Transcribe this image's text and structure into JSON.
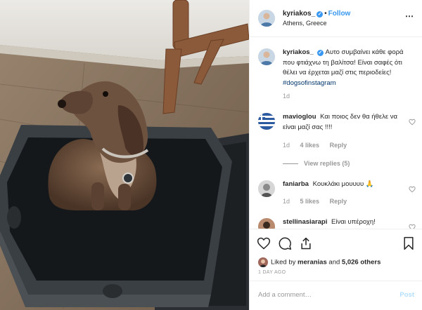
{
  "post": {
    "username": "kyriakos_",
    "verified_mark": "✓",
    "separator": "•",
    "follow_label": "Follow",
    "location": "Athens, Greece",
    "more_icon": "ellipsis-icon",
    "caption_user": "kyriakos_",
    "caption_text": "Αυτο συμβαίνει κάθε φορά που φτιάχνω τη βαλίτσα! Είναι σαφές ότι θέλει να έρχεται μαζί στις περιοδείες!",
    "caption_hashtag": "#dogsofinstagram",
    "caption_age": "1d"
  },
  "comments": [
    {
      "user": "mavioglou",
      "text": "Και ποιος δεν θα ήθελε να είναι μαζί σας !!!!",
      "age": "1d",
      "likes": "4 likes",
      "reply": "Reply",
      "view_replies": "View replies (5)"
    },
    {
      "user": "faniarba",
      "text": "Κουκλάκι μουυυυ 🙏",
      "age": "1d",
      "likes": "5 likes",
      "reply": "Reply"
    },
    {
      "user": "stellinasiarapi",
      "text": "Είναι υπέροχη!"
    }
  ],
  "actions": {
    "liked_prefix": "Liked by",
    "liked_user": "meranias",
    "liked_and": "and",
    "liked_count": "5,026 others",
    "date": "1 DAY AGO"
  },
  "add_comment": {
    "placeholder": "Add a comment…",
    "post_label": "Post"
  },
  "colors": {
    "link": "#3897f0",
    "hashtag": "#003569",
    "muted": "#999999"
  }
}
